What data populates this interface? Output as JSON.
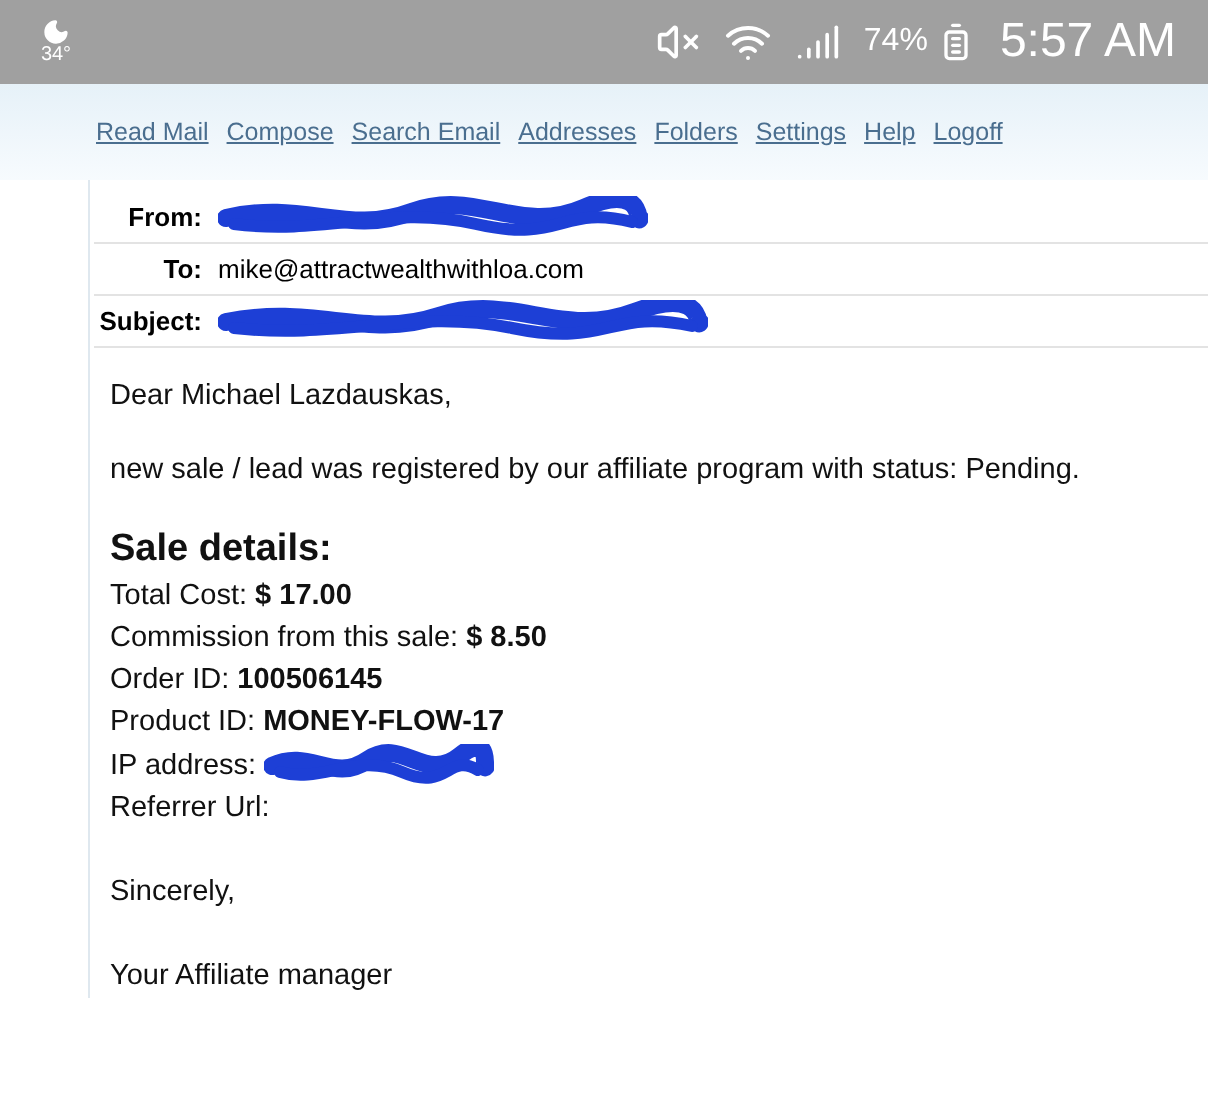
{
  "status_bar": {
    "temperature": "34°",
    "battery": "74%",
    "time": "5:57 AM"
  },
  "nav": [
    {
      "label": "Read Mail"
    },
    {
      "label": "Compose"
    },
    {
      "label": "Search Email"
    },
    {
      "label": "Addresses"
    },
    {
      "label": "Folders"
    },
    {
      "label": "Settings"
    },
    {
      "label": "Help"
    },
    {
      "label": "Logoff"
    }
  ],
  "header": [
    {
      "label": "From:",
      "redacted": true
    },
    {
      "label": "To:",
      "value": "mike@attractwealthwithloa.com",
      "redacted": false
    },
    {
      "label": "Subject:",
      "redacted": true
    }
  ],
  "body": {
    "greeting": "Dear Michael Lazdauskas,",
    "intro": "new sale / lead was registered by our affiliate program with status: Pending.",
    "details_title": "Sale details:",
    "details": [
      {
        "text": "Total Cost: **$ 17.00**",
        "redacted": false
      },
      {
        "text": "Commission from this sale: **$ 8.50**",
        "redacted": false
      },
      {
        "text": "Order ID: **100506145**",
        "redacted": false
      },
      {
        "text": "Product ID: **MONEY-FLOW-17**",
        "redacted": false
      },
      {
        "text": "IP address:",
        "redacted": true
      },
      {
        "text": "Referrer Url:",
        "redacted": false
      }
    ],
    "closing": "Sincerely,",
    "signature": "Your Affiliate manager"
  }
}
